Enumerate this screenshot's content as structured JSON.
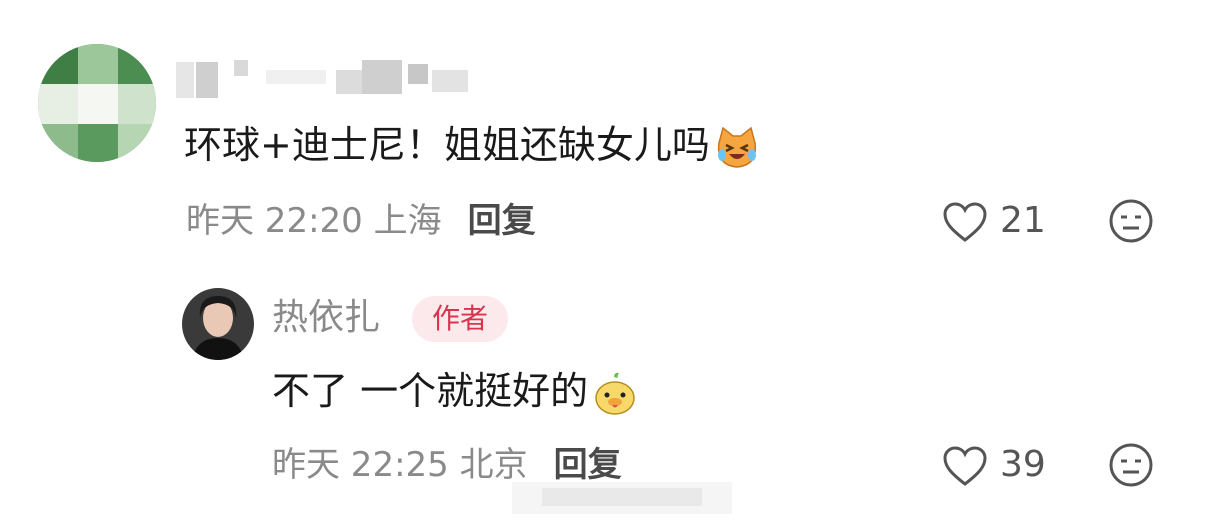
{
  "comments": [
    {
      "text": "环球+迪士尼！姐姐还缺女儿吗",
      "emoji": "crying-laughing-cat-icon",
      "time": "昨天 22:20",
      "location": "上海",
      "reply_label": "回复",
      "likes": "21",
      "reply": {
        "author": "热依扎",
        "badge": "作者",
        "text": "不了 一个就挺好的",
        "emoji": "yellow-duck-icon",
        "time": "昨天 22:25",
        "location": "北京",
        "reply_label": "回复",
        "likes": "39"
      }
    }
  ],
  "colors": {
    "accent_badge_bg": "#fbe9ec",
    "accent_badge_text": "#d8344e",
    "meta_text": "#8a8a8a",
    "body_text": "#1a1a1a"
  }
}
